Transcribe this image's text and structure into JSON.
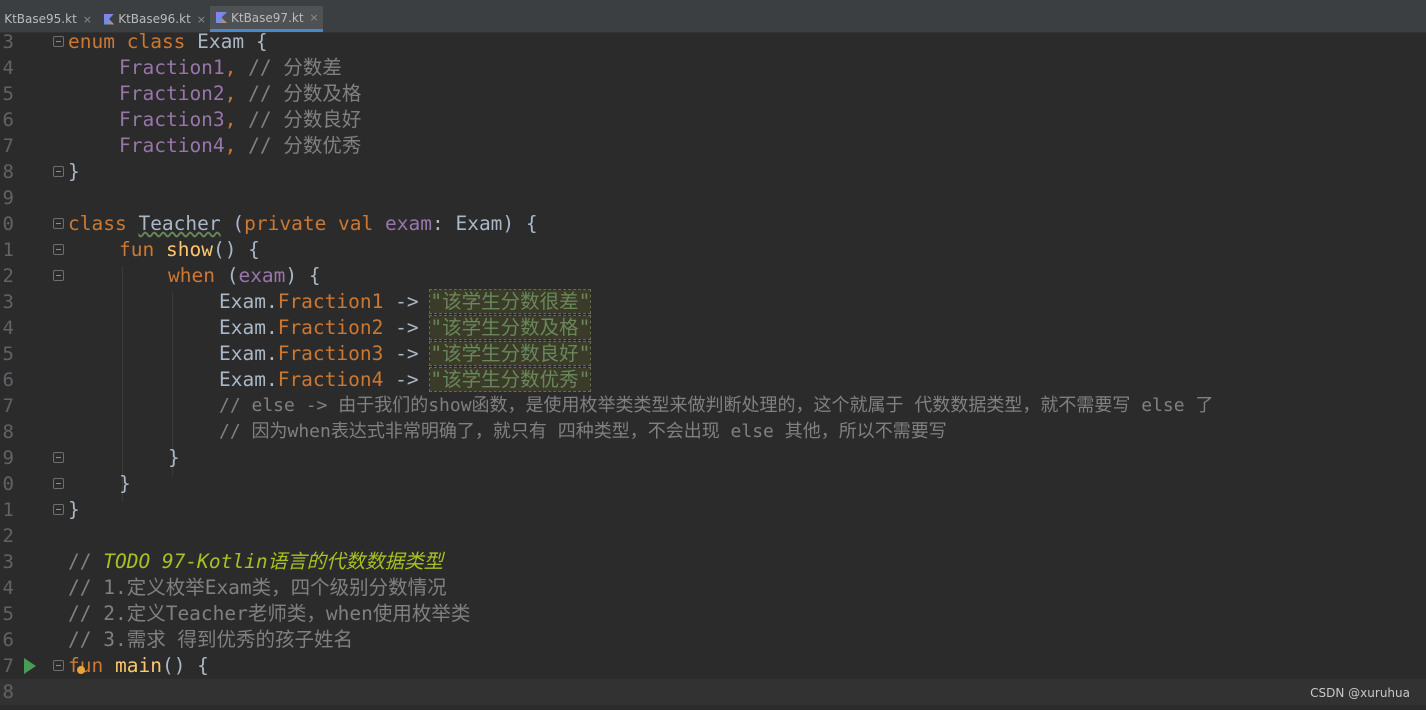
{
  "tabs": [
    {
      "label": "KtBase95.kt",
      "close": "×"
    },
    {
      "label": "KtBase96.kt",
      "close": "×"
    },
    {
      "label": "KtBase97.kt",
      "close": "×"
    }
  ],
  "line_numbers": [
    "3",
    "4",
    "5",
    "6",
    "7",
    "8",
    "9",
    "0",
    "1",
    "2",
    "3",
    "4",
    "5",
    "6",
    "7",
    "8",
    "9",
    "0",
    "1",
    "2",
    "3",
    "4",
    "5",
    "6",
    "7",
    "8"
  ],
  "code": {
    "l3": {
      "kw1": "enum",
      "kw2": "class",
      "name": "Exam",
      "brace": " {"
    },
    "l4": {
      "name": "Fraction1",
      "sep": ",",
      "comment": "// 分数差"
    },
    "l5": {
      "name": "Fraction2",
      "sep": ",",
      "comment": "// 分数及格"
    },
    "l6": {
      "name": "Fraction3",
      "sep": ",",
      "comment": "// 分数良好"
    },
    "l7": {
      "name": "Fraction4",
      "sep": ",",
      "comment": "// 分数优秀"
    },
    "l8": {
      "brace": "}"
    },
    "l10": {
      "kw": "class",
      "name": "Teacher",
      "open": " (",
      "kw2": "private val",
      "param": "exam",
      "rest": ": Exam) {"
    },
    "l11": {
      "kw": "fun",
      "name": "show",
      "rest": "() {"
    },
    "l12": {
      "kw": "when",
      "open": " (",
      "param": "exam",
      "rest": ") {"
    },
    "l13": {
      "recv": "Exam.",
      "member": "Fraction1",
      "arrow": " -> ",
      "str": "\"该学生分数很差\""
    },
    "l14": {
      "recv": "Exam.",
      "member": "Fraction2",
      "arrow": " -> ",
      "str": "\"该学生分数及格\""
    },
    "l15": {
      "recv": "Exam.",
      "member": "Fraction3",
      "arrow": " -> ",
      "str": "\"该学生分数良好\""
    },
    "l16": {
      "recv": "Exam.",
      "member": "Fraction4",
      "arrow": " -> ",
      "str": "\"该学生分数优秀\""
    },
    "l17": {
      "comment": "// else -> 由于我们的show函数，是使用枚举类类型来做判断处理的，这个就属于 代数数据类型，就不需要写 else 了"
    },
    "l18": {
      "comment": "// 因为when表达式非常明确了，就只有 四种类型，不会出现 else 其他，所以不需要写"
    },
    "l19": {
      "brace": "}"
    },
    "l20": {
      "brace": "}"
    },
    "l21": {
      "brace": "}"
    },
    "l23": {
      "prefix": "// ",
      "todo": "TODO 97-Kotlin语言的代数数据类型"
    },
    "l24": {
      "comment": "// 1.定义枚举Exam类，四个级别分数情况"
    },
    "l25": {
      "comment": "// 2.定义Teacher老师类，when使用枚举类"
    },
    "l26": {
      "comment": "// 3.需求 得到优秀的孩子姓名"
    },
    "l27": {
      "kw": "fun",
      "name": "main",
      "rest": "() {"
    }
  },
  "watermark": "CSDN @xuruhua",
  "colors": {
    "background": "#2b2b2b",
    "keyword": "#cc7832",
    "enum_constant": "#9876aa",
    "function": "#ffc66d",
    "string": "#6a8759",
    "comment": "#808080",
    "todo": "#a8c023"
  },
  "icons": {
    "run": "run-icon",
    "fold": "fold-icon",
    "intention": "bulb-icon",
    "file": "kotlin-file-icon"
  }
}
